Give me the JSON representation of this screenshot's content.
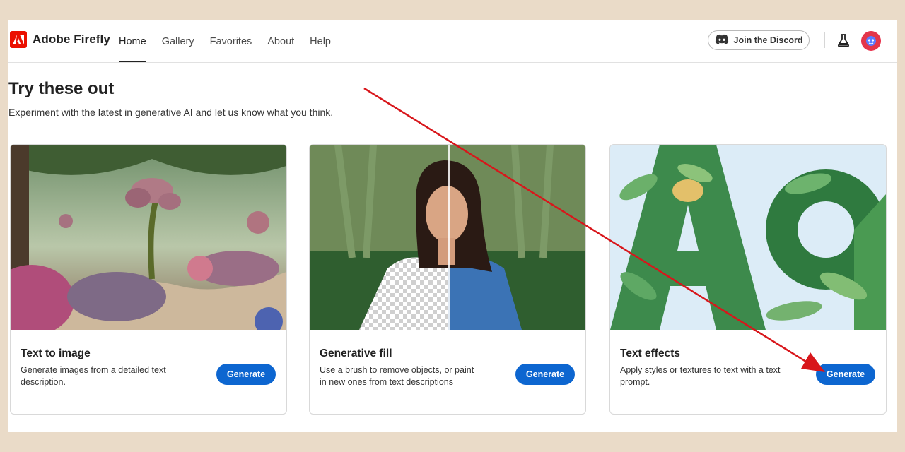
{
  "brand": {
    "name": "Adobe Firefly"
  },
  "nav": {
    "items": [
      {
        "label": "Home",
        "active": true
      },
      {
        "label": "Gallery"
      },
      {
        "label": "Favorites"
      },
      {
        "label": "About"
      },
      {
        "label": "Help"
      }
    ]
  },
  "header": {
    "discord_label": "Join the Discord"
  },
  "section": {
    "title": "Try these out",
    "subtitle": "Experiment with the latest in generative AI and let us know what you think."
  },
  "cards": [
    {
      "title": "Text to image",
      "description": "Generate images from a detailed text description.",
      "button": "Generate"
    },
    {
      "title": "Generative fill",
      "description": "Use a brush to remove objects, or paint in new ones from text descriptions",
      "button": "Generate"
    },
    {
      "title": "Text effects",
      "description": "Apply styles or textures to text with a text prompt.",
      "button": "Generate"
    }
  ],
  "colors": {
    "accent": "#0d66d0",
    "brand": "#eb1000",
    "annotation_arrow": "#d8161b",
    "background": "#eadbc8"
  }
}
